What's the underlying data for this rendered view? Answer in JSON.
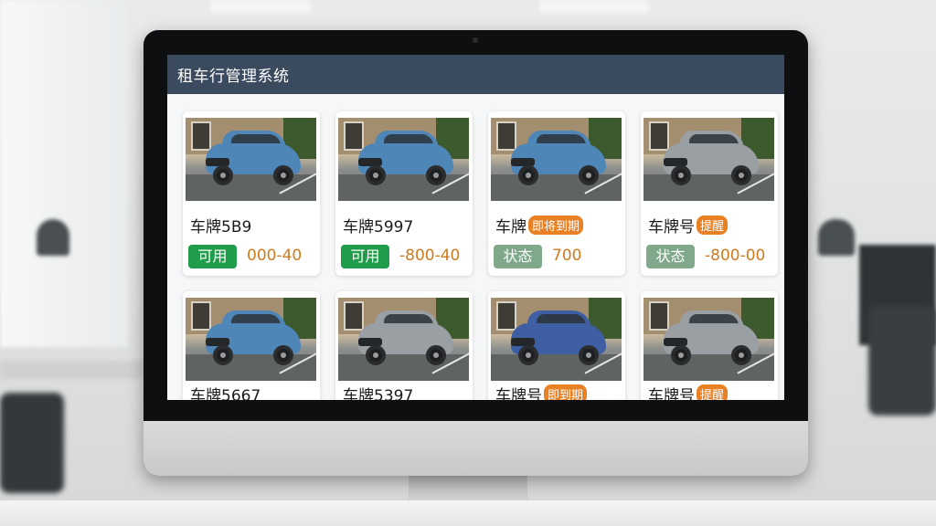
{
  "app": {
    "title": "租车行管理系统"
  },
  "cars": [
    {
      "plate": "车牌5B9",
      "tag": "",
      "status": "可用",
      "status_color": "#1f9d4a",
      "price": "000-40",
      "car_color": "#4f86b8"
    },
    {
      "plate": "车牌5997",
      "tag": "",
      "status": "可用",
      "status_color": "#1f9d4a",
      "price": "-800-40",
      "car_color": "#4f86b8"
    },
    {
      "plate": "车牌",
      "tag": "即将到期",
      "status": "状态",
      "status_color": "#7fa98a",
      "price": "700",
      "car_color": "#4f86b8"
    },
    {
      "plate": "车牌号",
      "tag": "提醒",
      "status": "状态",
      "status_color": "#7fa98a",
      "price": "-800-00",
      "car_color": "#9a9fa3"
    },
    {
      "plate": "车牌5667",
      "tag": "",
      "status": "",
      "status_color": "",
      "price": "",
      "car_color": "#4f86b8"
    },
    {
      "plate": "车牌5397",
      "tag": "",
      "status": "",
      "status_color": "",
      "price": "",
      "car_color": "#9a9fa3"
    },
    {
      "plate": "车牌号",
      "tag": "即到期",
      "status": "",
      "status_color": "",
      "price": "",
      "car_color": "#3e5fa3"
    },
    {
      "plate": "车牌号",
      "tag": "提醒",
      "status": "",
      "status_color": "",
      "price": "",
      "car_color": "#9a9fa3"
    }
  ]
}
